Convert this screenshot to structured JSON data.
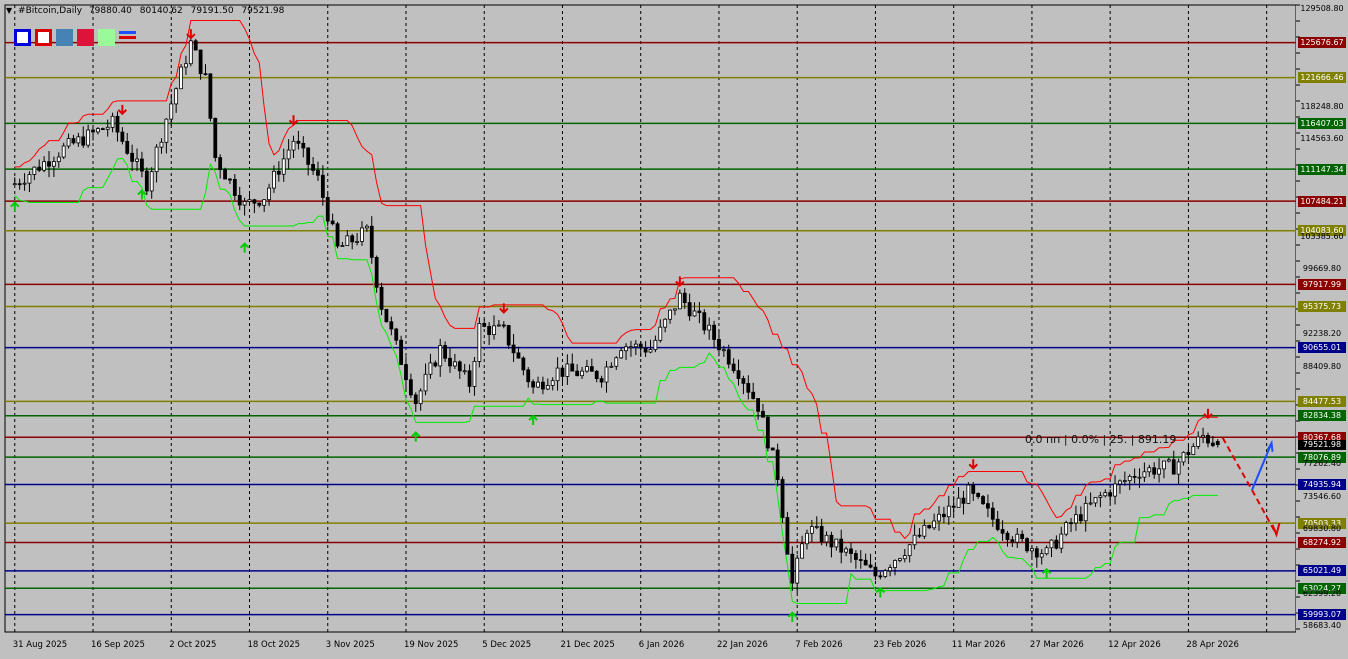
{
  "header": {
    "symbol": "#Bitcoin,Daily",
    "open": "79880.40",
    "high": "80140.62",
    "low": "79191.50",
    "close": "79521.98"
  },
  "toolbar": [
    "blue-frame",
    "red-frame",
    "steelblue",
    "crimson",
    "palegreen",
    "price-line"
  ],
  "annotation": "0.0 пп | 0.0% | 25. | 891.19",
  "price_axis": {
    "ticks": [
      "129508.80",
      "118248.80",
      "114563.60",
      "103385.60",
      "99669.80",
      "92238.20",
      "88409.80",
      "77262.40",
      "73546.60",
      "69830.80",
      "62399.20",
      "58683.40"
    ],
    "current_price": "79521.98"
  },
  "levels": [
    {
      "label": "125676.67",
      "price": 125676.67,
      "color": "#8b0000"
    },
    {
      "label": "121666.46",
      "price": 121666.46,
      "color": "#808000"
    },
    {
      "label": "116407.03",
      "price": 116407.03,
      "color": "#006400"
    },
    {
      "label": "111147.34",
      "price": 111147.34,
      "color": "#006400"
    },
    {
      "label": "107484.21",
      "price": 107484.21,
      "color": "#8b0000"
    },
    {
      "label": "104083.60",
      "price": 104083.6,
      "color": "#808000"
    },
    {
      "label": "97917.99",
      "price": 97917.99,
      "color": "#8b0000"
    },
    {
      "label": "95375.73",
      "price": 95375.73,
      "color": "#808000"
    },
    {
      "label": "90655.01",
      "price": 90655.01,
      "color": "#00008b"
    },
    {
      "label": "84477.53",
      "price": 84477.53,
      "color": "#808000"
    },
    {
      "label": "82834.38",
      "price": 82834.38,
      "color": "#006400"
    },
    {
      "label": "80367.68",
      "price": 80367.68,
      "color": "#8b0000"
    },
    {
      "label": "78076.89",
      "price": 78076.89,
      "color": "#006400"
    },
    {
      "label": "74935.94",
      "price": 74935.94,
      "color": "#00008b"
    },
    {
      "label": "70503.33",
      "price": 70503.33,
      "color": "#808000"
    },
    {
      "label": "68274.92",
      "price": 68274.92,
      "color": "#8b0000"
    },
    {
      "label": "65021.49",
      "price": 65021.49,
      "color": "#00008b"
    },
    {
      "label": "63024.27",
      "price": 63024.27,
      "color": "#006400"
    },
    {
      "label": "59993.07",
      "price": 59993.07,
      "color": "#00008b"
    }
  ],
  "colors": {
    "background": "#c0c0c0",
    "candle": "#000000",
    "upper_band": "#ff0000",
    "lower_band": "#00ee00",
    "fractal_up": "#00cc00",
    "fractal_down": "#dd0000",
    "projection_down": "#dd0000",
    "projection_up": "#1e50ff"
  },
  "chart_data": {
    "type": "candlestick",
    "timeframe": "Daily",
    "symbol": "#Bitcoin",
    "x_ticks": [
      "31 Aug 2025",
      "16 Sep 2025",
      "2 Oct 2025",
      "18 Oct 2025",
      "3 Nov 2025",
      "19 Nov 2025",
      "5 Dec 2025",
      "21 Dec 2025",
      "6 Jan 2026",
      "22 Jan 2026",
      "7 Feb 2026",
      "23 Feb 2026",
      "11 Mar 2026",
      "27 Mar 2026",
      "12 Apr 2026",
      "28 Apr 2026"
    ],
    "ylim": [
      58000,
      130000
    ],
    "grid": true,
    "close_path": [
      {
        "date": "2025-08-31",
        "close": 109500
      },
      {
        "date": "2025-09-10",
        "close": 113500
      },
      {
        "date": "2025-09-20",
        "close": 116400
      },
      {
        "date": "2025-09-27",
        "close": 109500
      },
      {
        "date": "2025-10-01",
        "close": 117000
      },
      {
        "date": "2025-10-06",
        "close": 125600
      },
      {
        "date": "2025-10-09",
        "close": 121500
      },
      {
        "date": "2025-10-11",
        "close": 112500
      },
      {
        "date": "2025-10-17",
        "close": 107000
      },
      {
        "date": "2025-10-21",
        "close": 108000
      },
      {
        "date": "2025-10-27",
        "close": 114500
      },
      {
        "date": "2025-11-01",
        "close": 110000
      },
      {
        "date": "2025-11-05",
        "close": 102000
      },
      {
        "date": "2025-11-11",
        "close": 104000
      },
      {
        "date": "2025-11-14",
        "close": 95500
      },
      {
        "date": "2025-11-21",
        "close": 84500
      },
      {
        "date": "2025-11-26",
        "close": 90500
      },
      {
        "date": "2025-12-02",
        "close": 86500
      },
      {
        "date": "2025-12-04",
        "close": 93000
      },
      {
        "date": "2025-12-09",
        "close": 92500
      },
      {
        "date": "2025-12-15",
        "close": 86000
      },
      {
        "date": "2025-12-20",
        "close": 88000
      },
      {
        "date": "2025-12-29",
        "close": 87500
      },
      {
        "date": "2026-01-02",
        "close": 91000
      },
      {
        "date": "2026-01-08",
        "close": 90500
      },
      {
        "date": "2026-01-14",
        "close": 96500
      },
      {
        "date": "2026-01-20",
        "close": 92500
      },
      {
        "date": "2026-01-26",
        "close": 88000
      },
      {
        "date": "2026-01-30",
        "close": 84000
      },
      {
        "date": "2026-02-03",
        "close": 76000
      },
      {
        "date": "2026-02-06",
        "close": 63500
      },
      {
        "date": "2026-02-09",
        "close": 70000
      },
      {
        "date": "2026-02-16",
        "close": 67500
      },
      {
        "date": "2026-02-23",
        "close": 64500
      },
      {
        "date": "2026-03-02",
        "close": 68000
      },
      {
        "date": "2026-03-07",
        "close": 70500
      },
      {
        "date": "2026-03-14",
        "close": 74000
      },
      {
        "date": "2026-03-19",
        "close": 71000
      },
      {
        "date": "2026-03-24",
        "close": 68500
      },
      {
        "date": "2026-03-30",
        "close": 67000
      },
      {
        "date": "2026-04-04",
        "close": 70500
      },
      {
        "date": "2026-04-10",
        "close": 73500
      },
      {
        "date": "2026-04-18",
        "close": 76500
      },
      {
        "date": "2026-04-25",
        "close": 77000
      },
      {
        "date": "2026-05-01",
        "close": 80500
      },
      {
        "date": "2026-05-04",
        "close": 79522
      }
    ],
    "fractals_down": [
      {
        "date": "2025-09-22",
        "price": 117500
      },
      {
        "date": "2025-10-06",
        "price": 126200
      },
      {
        "date": "2025-10-27",
        "price": 116300
      },
      {
        "date": "2025-12-09",
        "price": 94700
      },
      {
        "date": "2026-01-14",
        "price": 97800
      },
      {
        "date": "2026-03-15",
        "price": 76800
      },
      {
        "date": "2026-05-02",
        "price": 82600
      }
    ],
    "fractals_up": [
      {
        "date": "2025-08-31",
        "price": 107300
      },
      {
        "date": "2025-09-26",
        "price": 108700
      },
      {
        "date": "2025-10-17",
        "price": 102600
      },
      {
        "date": "2025-11-21",
        "price": 80900
      },
      {
        "date": "2025-12-15",
        "price": 82800
      },
      {
        "date": "2026-02-06",
        "price": 60200
      },
      {
        "date": "2026-02-24",
        "price": 63000
      },
      {
        "date": "2026-03-30",
        "price": 65200
      }
    ]
  }
}
